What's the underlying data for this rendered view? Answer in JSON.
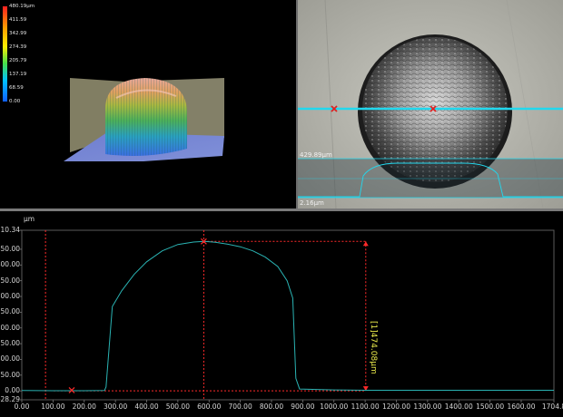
{
  "view3d": {
    "colorbar_labels": [
      "480.19μm",
      "411.59",
      "342.99",
      "274.39",
      "205.79",
      "137.19",
      "68.59",
      "0.00"
    ],
    "colorbar_colors": [
      "#ff2020",
      "#ff9a00",
      "#ffee00",
      "#46e04a",
      "#00c0ff",
      "#1060ff"
    ]
  },
  "camera": {
    "height_label": "429.89μm",
    "depth_label": "2.16μm",
    "line_color": "#22d8ee",
    "marker_color": "#e02020"
  },
  "profile": {
    "unit_label": "μm",
    "height_label": "[1]474.08μm",
    "line_color": "#2ab3b3",
    "marker_color": "#ff2a2a",
    "label_color": "#e8e84a"
  },
  "chart_data": {
    "type": "line",
    "title": "",
    "xlabel": "",
    "ylabel": "μm",
    "xlim": [
      0,
      1704.8
    ],
    "ylim": [
      -28.29,
      510.34
    ],
    "x_ticks": [
      "0.00",
      "100.00",
      "200.00",
      "300.00",
      "400.00",
      "500.00",
      "600.00",
      "700.00",
      "800.00",
      "900.00",
      "1000.00",
      "1100.00",
      "1200.00",
      "1300.00",
      "1400.00",
      "1500.00",
      "1600.00",
      "1704.8"
    ],
    "y_ticks": [
      {
        "value": 510.34,
        "label": "510.34"
      },
      {
        "value": 450,
        "label": "450.00"
      },
      {
        "value": 400,
        "label": "400.00"
      },
      {
        "value": 350,
        "label": "350.00"
      },
      {
        "value": 300,
        "label": "300.00"
      },
      {
        "value": 250,
        "label": "250.00"
      },
      {
        "value": 200,
        "label": "200.00"
      },
      {
        "value": 150,
        "label": "150.00"
      },
      {
        "value": 100,
        "label": "100.00"
      },
      {
        "value": 50,
        "label": "50.00"
      },
      {
        "value": 0,
        "label": "0.00"
      },
      {
        "value": -28.29,
        "label": "-28.29"
      }
    ],
    "series": [
      {
        "x": [
          0,
          100,
          200,
          265,
          270,
          290,
          320,
          360,
          400,
          450,
          500,
          550,
          585,
          620,
          660,
          700,
          740,
          780,
          820,
          850,
          868,
          878,
          890,
          1000,
          1100,
          1704.8
        ],
        "y": [
          1,
          0.5,
          0.5,
          1,
          13,
          268,
          318,
          370,
          410,
          445,
          465,
          473,
          475,
          472,
          466,
          458,
          445,
          425,
          395,
          350,
          295,
          40,
          6,
          3,
          2,
          2
        ]
      }
    ],
    "markers": [
      {
        "x": 160,
        "y": 2
      },
      {
        "x": 583,
        "y": 475
      }
    ],
    "cursor_lines_x": [
      76,
      583
    ],
    "measure": {
      "x": 1102,
      "y_top": 475,
      "y_bottom": 0
    }
  }
}
